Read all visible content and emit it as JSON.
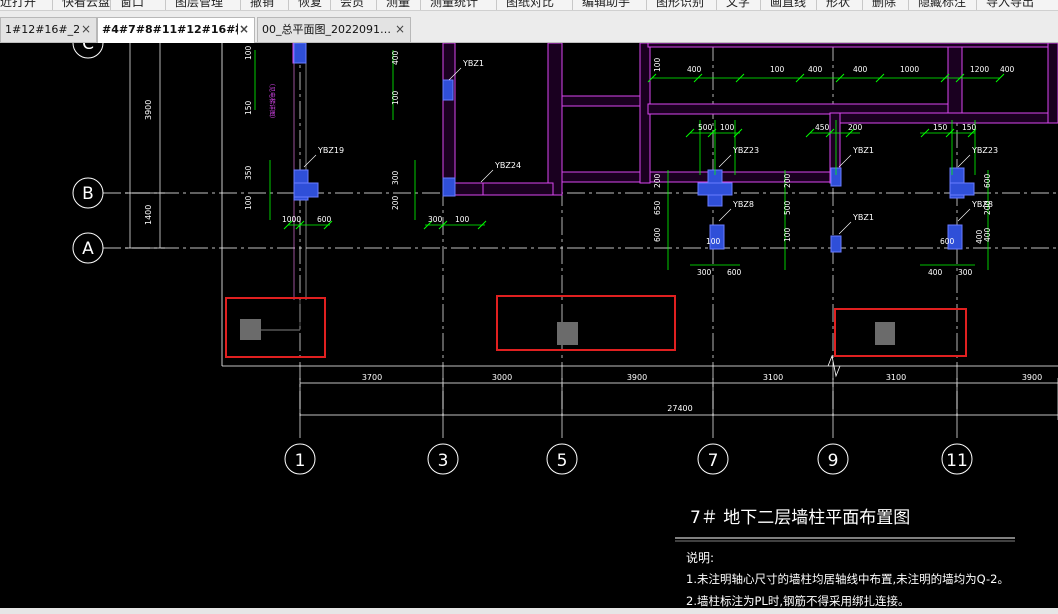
{
  "menu": [
    "近打开",
    "快看云盘",
    "窗口",
    "图层管理",
    "撤销",
    "恢复",
    "会员",
    "测量",
    "测量统计",
    "图纸对比",
    "编辑助手",
    "图形识别",
    "文字",
    "画直线",
    "形状",
    "删除",
    "隐藏标注",
    "导入导出"
  ],
  "tabs": [
    {
      "label": "1#12#16#_2…",
      "active": false
    },
    {
      "label": "#4#7#8#11#12#16#楼·",
      "active": true
    },
    {
      "label": "00_总平面图_2022091…",
      "active": false
    }
  ],
  "tab_close": "×",
  "colors": {
    "background": "#000000",
    "dim": "#00ff00",
    "wall": "#d946ef",
    "column": "#2f4fd8",
    "axis": "#ffffff",
    "highlight": "#e02020",
    "text": "#ffffff"
  },
  "drawing": {
    "axes": {
      "rows": [
        "C",
        "B",
        "A"
      ],
      "cols": [
        "1",
        "3",
        "5",
        "7",
        "9",
        "11"
      ]
    },
    "left_dims": [
      "3900",
      "1400"
    ],
    "bottom_dims": [
      "3700",
      "3000",
      "3900",
      "3100",
      "3100",
      "3900"
    ],
    "total_dim": "27400",
    "labels": [
      "YBZ19",
      "YBZ1",
      "YBZ24",
      "YBZ23",
      "YBZ1",
      "YBZ1",
      "YBZ23",
      "YBZ8",
      "YBZ8"
    ],
    "dims": [
      "100",
      "400",
      "100",
      "400",
      "400",
      "1000",
      "1200",
      "400",
      "500",
      "100",
      "450",
      "200",
      "150",
      "150",
      "200",
      "650",
      "600",
      "200",
      "500",
      "100",
      "600",
      "200",
      "400",
      "100",
      "150",
      "350",
      "100",
      "1000",
      "600",
      "400",
      "100",
      "300",
      "200",
      "300",
      "100",
      "300",
      "600",
      "400",
      "300",
      "100",
      "600",
      "400"
    ],
    "magenta_note": "（见电梯详图）",
    "title": "7＃ 地下二层墙柱平面布置图",
    "notes_heading": "说明:",
    "notes": [
      "1.未注明轴心尺寸的墙柱均居轴线中布置,未注明的墙均为Q-2。",
      "2.墙柱标注为PL时,钢筋不得采用绑扎连接。"
    ]
  }
}
